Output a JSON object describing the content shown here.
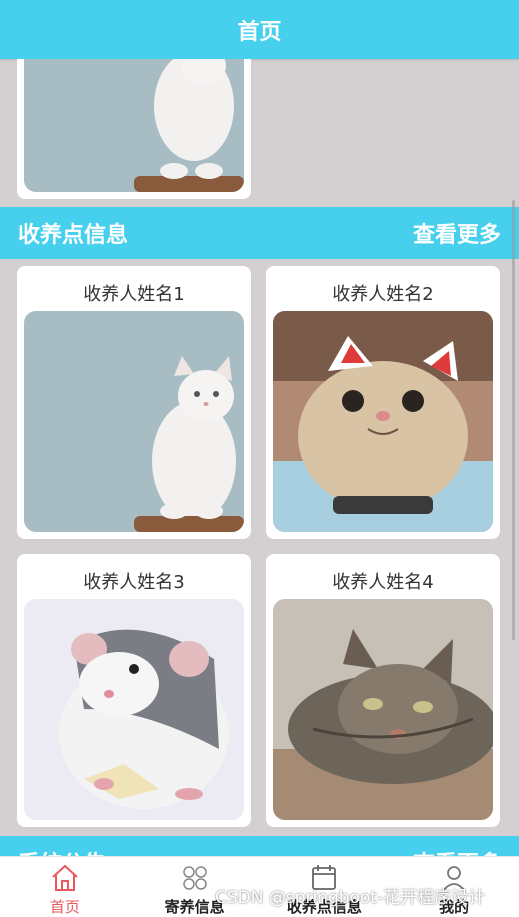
{
  "header": {
    "title": "首页"
  },
  "section": {
    "title": "收养点信息",
    "more_label": "查看更多"
  },
  "cards": [
    {
      "name": "收养人姓名1",
      "image": "white-cat"
    },
    {
      "name": "收养人姓名2",
      "image": "cat-costume"
    },
    {
      "name": "收养人姓名3",
      "image": "rat"
    },
    {
      "name": "收养人姓名4",
      "image": "tabby-cat"
    }
  ],
  "next_section": {
    "title": "系统公告",
    "more_label": "查看更多"
  },
  "tabbar": [
    {
      "label": "首页",
      "icon": "home-icon",
      "active": true
    },
    {
      "label": "寄养信息",
      "icon": "flower-icon",
      "active": false
    },
    {
      "label": "收养点信息",
      "icon": "calendar-icon",
      "active": false
    },
    {
      "label": "我的",
      "icon": "user-icon",
      "active": false
    }
  ],
  "watermark": "CSDN @springboot-花开程序设计",
  "colors": {
    "accent": "#47d0ee",
    "active_tab": "#e8585d",
    "background": "#d4d0d1"
  }
}
